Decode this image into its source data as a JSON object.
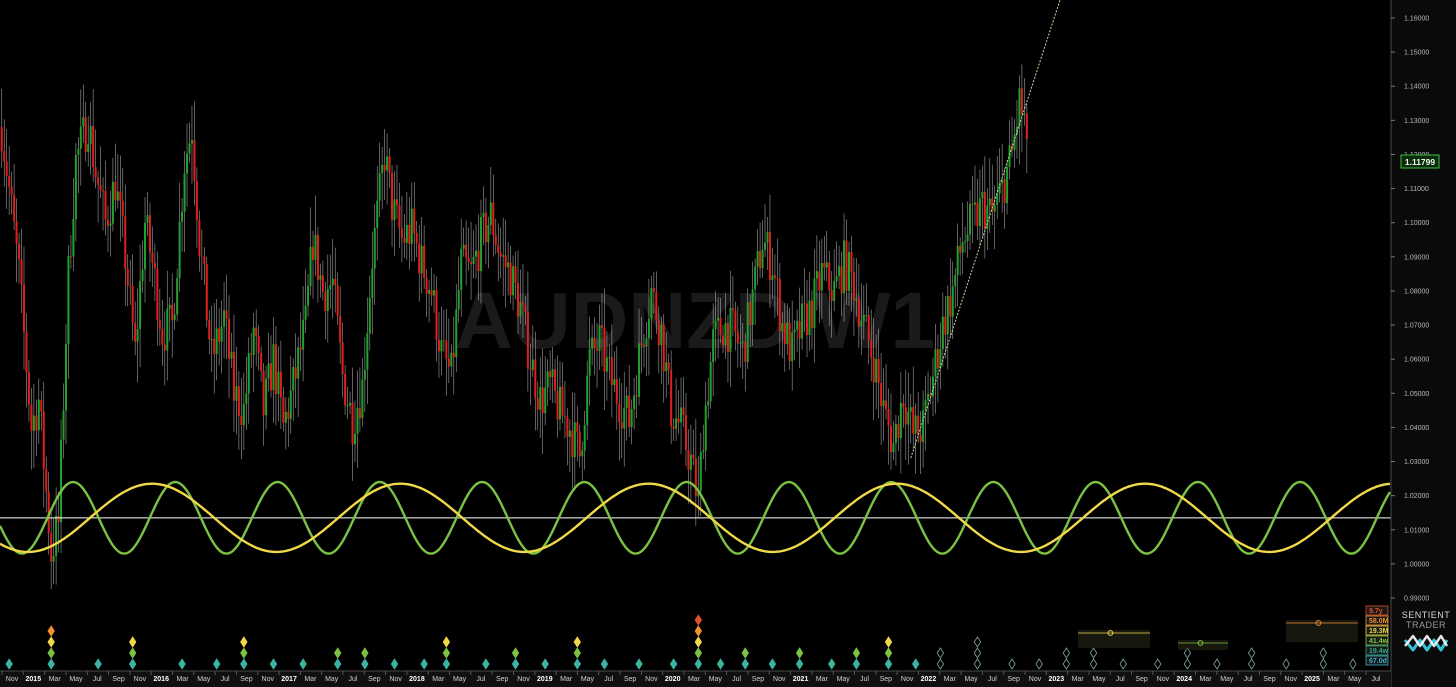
{
  "chart_data": {
    "type": "candlestick",
    "watermark": "AUDNZD W1",
    "last_price": "1.11799",
    "ylim": [
      0.985,
      1.168
    ],
    "y_ticks": [
      "1.16000",
      "1.15000",
      "1.14000",
      "1.13000",
      "1.12000",
      "1.11000",
      "1.10000",
      "1.09000",
      "1.08000",
      "1.07000",
      "1.06000",
      "1.05000",
      "1.04000",
      "1.03000",
      "1.02000",
      "1.01000",
      "1.00000",
      "0.99000"
    ],
    "x_range": [
      "2014-10-15",
      "2025-07-31"
    ],
    "x_labels": [
      "Nov",
      "2015",
      "Mar",
      "May",
      "Jul",
      "Sep",
      "Nov",
      "2016",
      "Mar",
      "May",
      "Jul",
      "Sep",
      "Nov",
      "2017",
      "Mar",
      "May",
      "Jul",
      "Sep",
      "Nov",
      "2018",
      "Mar",
      "May",
      "Jul",
      "Sep",
      "Nov",
      "2019",
      "Mar",
      "May",
      "Jul",
      "Sep",
      "Nov",
      "2020",
      "Mar",
      "May",
      "Jul",
      "Sep",
      "Nov",
      "2021",
      "Mar",
      "May",
      "Jul",
      "Sep",
      "Nov",
      "2022",
      "Mar",
      "May",
      "Jul",
      "Sep",
      "Nov",
      "2023",
      "Mar",
      "May",
      "Jul",
      "Sep",
      "Nov",
      "2024",
      "Mar",
      "May",
      "Jul",
      "Sep",
      "Nov",
      "2025",
      "Mar",
      "May",
      "Jul"
    ],
    "price_path": [
      [
        "2014-10-20",
        1.128
      ],
      [
        "2014-11-10",
        1.11
      ],
      [
        "2014-12-08",
        1.085
      ],
      [
        "2015-01-12",
        1.04
      ],
      [
        "2015-02-02",
        1.048
      ],
      [
        "2015-03-09",
        1.003
      ],
      [
        "2015-03-30",
        1.012
      ],
      [
        "2015-04-27",
        1.085
      ],
      [
        "2015-05-18",
        1.118
      ],
      [
        "2015-06-22",
        1.13
      ],
      [
        "2015-07-13",
        1.115
      ],
      [
        "2015-08-10",
        1.1
      ],
      [
        "2015-09-07",
        1.112
      ],
      [
        "2015-10-05",
        1.09
      ],
      [
        "2015-11-02",
        1.062
      ],
      [
        "2015-11-30",
        1.1
      ],
      [
        "2015-12-21",
        1.088
      ],
      [
        "2016-01-18",
        1.068
      ],
      [
        "2016-02-15",
        1.07
      ],
      [
        "2016-03-21",
        1.118
      ],
      [
        "2016-04-11",
        1.128
      ],
      [
        "2016-05-02",
        1.095
      ],
      [
        "2016-06-06",
        1.06
      ],
      [
        "2016-07-11",
        1.072
      ],
      [
        "2016-08-08",
        1.05
      ],
      [
        "2016-09-05",
        1.045
      ],
      [
        "2016-10-03",
        1.068
      ],
      [
        "2016-10-31",
        1.045
      ],
      [
        "2016-11-28",
        1.06
      ],
      [
        "2016-12-26",
        1.04
      ],
      [
        "2017-01-23",
        1.052
      ],
      [
        "2017-02-27",
        1.07
      ],
      [
        "2017-03-20",
        1.095
      ],
      [
        "2017-04-17",
        1.08
      ],
      [
        "2017-05-15",
        1.082
      ],
      [
        "2017-06-12",
        1.055
      ],
      [
        "2017-07-10",
        1.042
      ],
      [
        "2017-08-07",
        1.052
      ],
      [
        "2017-09-04",
        1.09
      ],
      [
        "2017-10-09",
        1.12
      ],
      [
        "2017-10-30",
        1.105
      ],
      [
        "2017-11-27",
        1.095
      ],
      [
        "2017-12-25",
        1.098
      ],
      [
        "2018-01-22",
        1.088
      ],
      [
        "2018-02-19",
        1.08
      ],
      [
        "2018-03-19",
        1.062
      ],
      [
        "2018-04-16",
        1.055
      ],
      [
        "2018-05-14",
        1.088
      ],
      [
        "2018-06-11",
        1.085
      ],
      [
        "2018-07-09",
        1.095
      ],
      [
        "2018-08-06",
        1.102
      ],
      [
        "2018-09-03",
        1.09
      ],
      [
        "2018-10-01",
        1.085
      ],
      [
        "2018-10-29",
        1.075
      ],
      [
        "2018-11-26",
        1.06
      ],
      [
        "2018-12-24",
        1.048
      ],
      [
        "2019-01-21",
        1.052
      ],
      [
        "2019-02-18",
        1.045
      ],
      [
        "2019-03-18",
        1.04
      ],
      [
        "2019-04-15",
        1.032
      ],
      [
        "2019-05-13",
        1.06
      ],
      [
        "2019-06-10",
        1.065
      ],
      [
        "2019-07-08",
        1.055
      ],
      [
        "2019-08-05",
        1.048
      ],
      [
        "2019-09-02",
        1.042
      ],
      [
        "2019-10-07",
        1.065
      ],
      [
        "2019-11-04",
        1.08
      ],
      [
        "2019-12-02",
        1.068
      ],
      [
        "2019-12-30",
        1.045
      ],
      [
        "2020-01-27",
        1.04
      ],
      [
        "2020-02-24",
        1.03
      ],
      [
        "2020-03-16",
        1.018
      ],
      [
        "2020-03-30",
        1.04
      ],
      [
        "2020-04-27",
        1.065
      ],
      [
        "2020-05-25",
        1.07
      ],
      [
        "2020-06-22",
        1.068
      ],
      [
        "2020-07-20",
        1.062
      ],
      [
        "2020-08-17",
        1.078
      ],
      [
        "2020-09-14",
        1.095
      ],
      [
        "2020-10-12",
        1.088
      ],
      [
        "2020-11-09",
        1.07
      ],
      [
        "2020-12-07",
        1.062
      ],
      [
        "2021-01-04",
        1.07
      ],
      [
        "2021-02-01",
        1.075
      ],
      [
        "2021-03-01",
        1.085
      ],
      [
        "2021-04-05",
        1.08
      ],
      [
        "2021-05-03",
        1.088
      ],
      [
        "2021-05-31",
        1.082
      ],
      [
        "2021-06-28",
        1.07
      ],
      [
        "2021-07-26",
        1.06
      ],
      [
        "2021-08-23",
        1.045
      ],
      [
        "2021-09-20",
        1.035
      ],
      [
        "2021-10-18",
        1.05
      ],
      [
        "2021-11-15",
        1.038
      ],
      [
        "2021-12-13",
        1.04
      ],
      [
        "2022-01-10",
        1.055
      ],
      [
        "2022-02-07",
        1.07
      ],
      [
        "2022-03-07",
        1.08
      ],
      [
        "2022-04-04",
        1.095
      ],
      [
        "2022-05-02",
        1.1
      ],
      [
        "2022-05-30",
        1.105
      ],
      [
        "2022-06-27",
        1.102
      ],
      [
        "2022-07-25",
        1.11
      ],
      [
        "2022-08-22",
        1.12
      ],
      [
        "2022-09-12",
        1.135
      ],
      [
        "2022-09-26",
        1.13
      ],
      [
        "2022-10-03",
        1.118
      ]
    ],
    "trendline": {
      "from": [
        "2021-11-08",
        1.031
      ],
      "to": [
        "2023-01-20",
        1.17
      ]
    },
    "baseline": 1.0135,
    "series": [
      {
        "color": "#7cc242",
        "period_weeks": 41.4,
        "amplitude": 0.0105,
        "peak": "2015-05-10"
      },
      {
        "color": "#f0d84a",
        "period_weeks": 100.5,
        "amplitude": 0.01,
        "peak": "2015-12-20"
      }
    ],
    "markers": [
      {
        "d": "2014-11-10",
        "stack": [
          "#3cb4a0"
        ]
      },
      {
        "d": "2015-03-09",
        "stack": [
          "#3cb4a0",
          "#7cc242",
          "#f0d84a",
          "#f09030"
        ]
      },
      {
        "d": "2015-07-20",
        "stack": [
          "#3cb4a0"
        ]
      },
      {
        "d": "2015-10-26",
        "stack": [
          "#3cb4a0",
          "#7cc242",
          "#f0d84a"
        ]
      },
      {
        "d": "2016-03-14",
        "stack": [
          "#3cb4a0"
        ]
      },
      {
        "d": "2016-06-20",
        "stack": [
          "#3cb4a0"
        ]
      },
      {
        "d": "2016-09-05",
        "stack": [
          "#3cb4a0",
          "#7cc242",
          "#f0d84a"
        ]
      },
      {
        "d": "2016-11-28",
        "stack": [
          "#3cb4a0"
        ]
      },
      {
        "d": "2017-02-20",
        "stack": [
          "#3cb4a0"
        ]
      },
      {
        "d": "2017-05-29",
        "stack": [
          "#3cb4a0",
          "#7cc242"
        ]
      },
      {
        "d": "2017-08-14",
        "stack": [
          "#3cb4a0",
          "#7cc242"
        ]
      },
      {
        "d": "2017-11-06",
        "stack": [
          "#3cb4a0"
        ]
      },
      {
        "d": "2018-01-29",
        "stack": [
          "#3cb4a0"
        ]
      },
      {
        "d": "2018-04-02",
        "stack": [
          "#3cb4a0",
          "#7cc242",
          "#f0d84a"
        ]
      },
      {
        "d": "2018-07-23",
        "stack": [
          "#3cb4a0"
        ]
      },
      {
        "d": "2018-10-15",
        "stack": [
          "#3cb4a0",
          "#7cc242"
        ]
      },
      {
        "d": "2019-01-07",
        "stack": [
          "#3cb4a0"
        ]
      },
      {
        "d": "2019-04-08",
        "stack": [
          "#3cb4a0",
          "#7cc242",
          "#f0d84a"
        ]
      },
      {
        "d": "2019-06-24",
        "stack": [
          "#3cb4a0"
        ]
      },
      {
        "d": "2019-09-30",
        "stack": [
          "#3cb4a0"
        ]
      },
      {
        "d": "2020-01-06",
        "stack": [
          "#3cb4a0"
        ]
      },
      {
        "d": "2020-03-16",
        "stack": [
          "#3cb4a0",
          "#7cc242",
          "#f0d84a",
          "#f09030",
          "#e0502a"
        ]
      },
      {
        "d": "2020-05-18",
        "stack": [
          "#3cb4a0"
        ]
      },
      {
        "d": "2020-07-27",
        "stack": [
          "#3cb4a0",
          "#7cc242"
        ]
      },
      {
        "d": "2020-10-12",
        "stack": [
          "#3cb4a0"
        ]
      },
      {
        "d": "2020-12-28",
        "stack": [
          "#3cb4a0",
          "#7cc242"
        ]
      },
      {
        "d": "2021-03-29",
        "stack": [
          "#3cb4a0"
        ]
      },
      {
        "d": "2021-06-07",
        "stack": [
          "#3cb4a0",
          "#7cc242"
        ]
      },
      {
        "d": "2021-09-06",
        "stack": [
          "#3cb4a0",
          "#7cc242",
          "#f0d84a"
        ]
      },
      {
        "d": "2021-11-22",
        "stack": [
          "#3cb4a0"
        ]
      },
      {
        "d": "2022-01-31",
        "hollow": true,
        "stack": [
          "#3cb4a0",
          "#7cc242"
        ]
      },
      {
        "d": "2022-05-16",
        "hollow": true,
        "stack": [
          "#3cb4a0",
          "#7cc242",
          "#7cc242"
        ]
      },
      {
        "d": "2022-08-22",
        "hollow": true,
        "stack": [
          "#3cb4a0"
        ]
      },
      {
        "d": "2022-11-07",
        "hollow": true,
        "stack": [
          "#3cb4a0"
        ]
      },
      {
        "d": "2023-01-23",
        "hollow": true,
        "stack": [
          "#3cb4a0",
          "#7cc242"
        ]
      },
      {
        "d": "2023-04-10",
        "hollow": true,
        "stack": [
          "#3cb4a0",
          "#7cc242"
        ]
      },
      {
        "d": "2023-07-03",
        "hollow": true,
        "stack": [
          "#3cb4a0"
        ]
      },
      {
        "d": "2023-10-09",
        "hollow": true,
        "stack": [
          "#3cb4a0"
        ]
      },
      {
        "d": "2024-01-01",
        "hollow": true,
        "stack": [
          "#3cb4a0",
          "#7cc242"
        ]
      },
      {
        "d": "2024-03-25",
        "hollow": true,
        "stack": [
          "#3cb4a0"
        ]
      },
      {
        "d": "2024-07-01",
        "hollow": true,
        "stack": [
          "#3cb4a0",
          "#7cc242"
        ]
      },
      {
        "d": "2024-10-07",
        "hollow": true,
        "stack": [
          "#3cb4a0"
        ]
      },
      {
        "d": "2025-01-20",
        "hollow": true,
        "stack": [
          "#3cb4a0",
          "#7cc242"
        ]
      },
      {
        "d": "2025-04-14",
        "hollow": true,
        "stack": [
          "#3cb4a0"
        ]
      }
    ],
    "legend": [
      {
        "label": "9.7y",
        "color": "#e0502a"
      },
      {
        "label": "58.0M",
        "color": "#f09030"
      },
      {
        "label": "19.3M",
        "color": "#f0d84a"
      },
      {
        "label": "41.4w",
        "color": "#7cc242"
      },
      {
        "label": "19.4w",
        "color": "#2fa585"
      },
      {
        "label": "67.0d",
        "color": "#3ab0c8"
      }
    ]
  },
  "branding": {
    "line1": "SENTIENT",
    "line2": "TRADER"
  },
  "colors": {
    "up": "#1fa32a",
    "down": "#e0201a",
    "wick": "#c8c8c8",
    "baseline": "#ffffff",
    "trendline": "#b8e0a0"
  }
}
